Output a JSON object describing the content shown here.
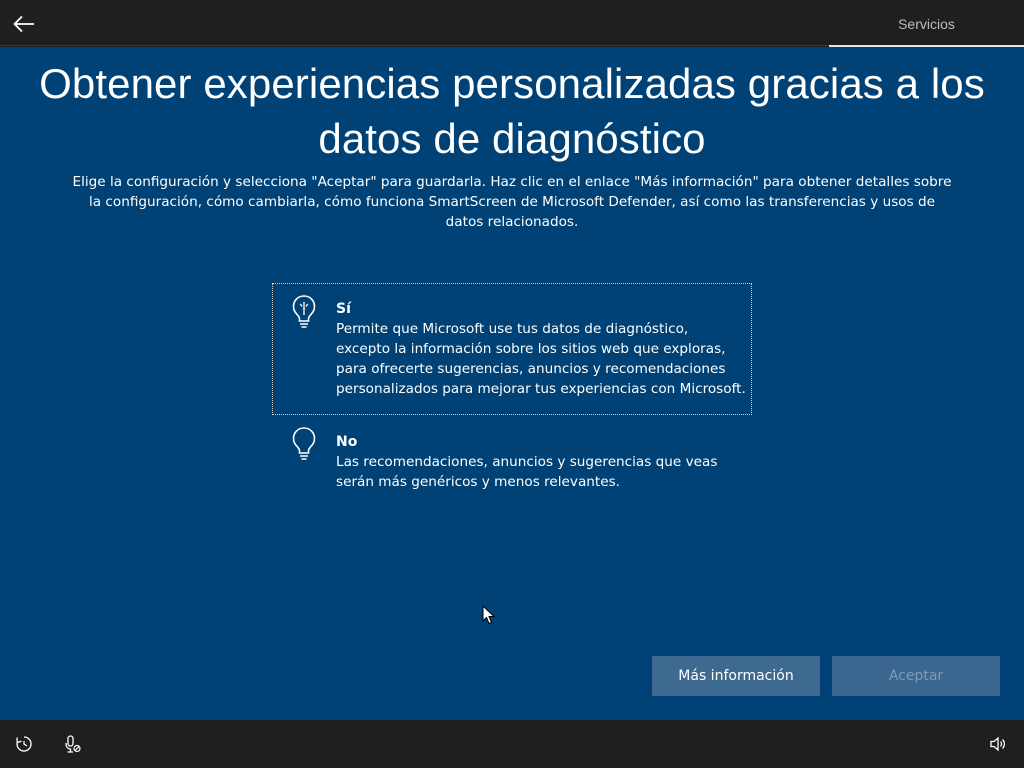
{
  "header": {
    "tab_label": "Servicios"
  },
  "page": {
    "title": "Obtener experiencias personalizadas gracias a los datos de diagnóstico",
    "description": "Elige la configuración y selecciona \"Aceptar\" para guardarla. Haz clic en el enlace \"Más información\" para obtener detalles sobre la configuración, cómo cambiarla, cómo funciona SmartScreen de Microsoft Defender, así como las transferencias y usos de datos relacionados."
  },
  "options": [
    {
      "title": "Sí",
      "body": "Permite que Microsoft use tus datos de diagnóstico, excepto la información sobre los sitios web que exploras, para ofrecerte sugerencias, anuncios y recomendaciones personalizados para mejorar tus experiencias con Microsoft.",
      "icon": "lightbulb-on-icon",
      "selected": true
    },
    {
      "title": "No",
      "body": "Las recomendaciones, anuncios y sugerencias que veas serán más genéricos y menos relevantes.",
      "icon": "lightbulb-off-icon",
      "selected": false
    }
  ],
  "buttons": {
    "more_info": "Más información",
    "accept": "Aceptar"
  },
  "footer": {
    "icons": [
      "ease-of-access-icon",
      "microphone-icon",
      "volume-icon"
    ]
  },
  "colors": {
    "background": "#004275",
    "bar": "#1f1f1f",
    "button": "#3e6991"
  }
}
